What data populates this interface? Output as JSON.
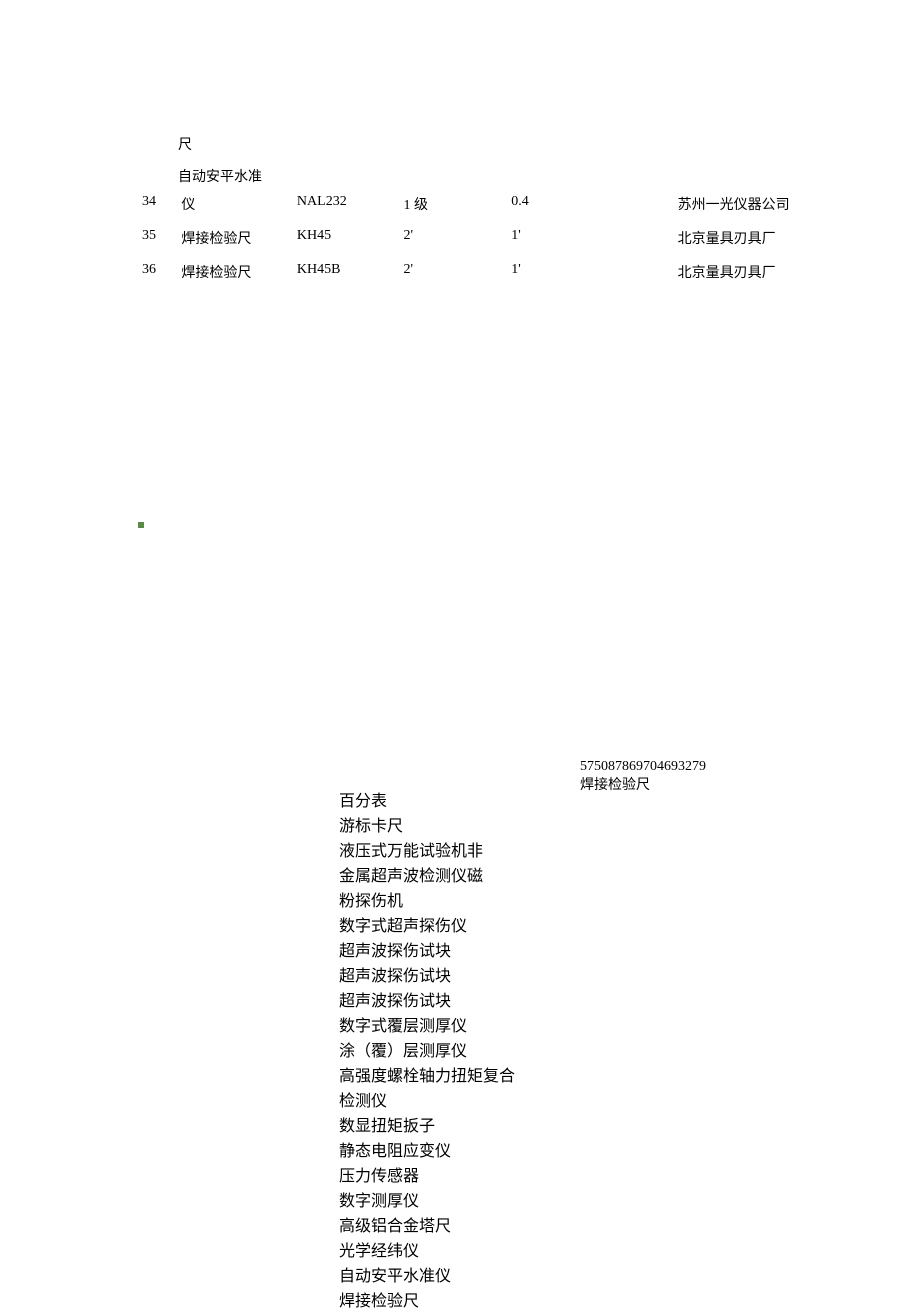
{
  "top": {
    "pre_label_1": "尺",
    "pre_label_2": "自动安平水准",
    "rows": [
      {
        "idx": "34",
        "name": "仪",
        "model": "NAL232",
        "grade": "1 级",
        "val": "0.4",
        "vendor": "苏州一光仪器公司"
      },
      {
        "idx": "35",
        "name": "焊接检验尺",
        "model": "KH45",
        "grade": "2'",
        "val": "1'",
        "vendor": "北京量具刃具厂"
      },
      {
        "idx": "36",
        "name": "焊接检验尺",
        "model": "KH45B",
        "grade": "2'",
        "val": "1'",
        "vendor": "北京量具刃具厂"
      }
    ]
  },
  "right_block": {
    "code": "575087869704693279",
    "label": "焊接检验尺"
  },
  "center_list": [
    "百分表",
    "游标卡尺",
    "液压式万能试验机非",
    "金属超声波检测仪磁",
    "粉探伤机",
    "数字式超声探伤仪",
    "超声波探伤试块",
    "超声波探伤试块",
    "超声波探伤试块",
    "数字式覆层测厚仪",
    "涂（覆）层测厚仪",
    "高强度螺栓轴力扭矩复合",
    "检测仪",
    "数显扭矩扳子",
    "静态电阻应变仪",
    "压力传感器",
    "数字测厚仪",
    "高级铝合金塔尺",
    "光学经纬仪",
    "自动安平水准仪",
    "焊接检验尺"
  ]
}
